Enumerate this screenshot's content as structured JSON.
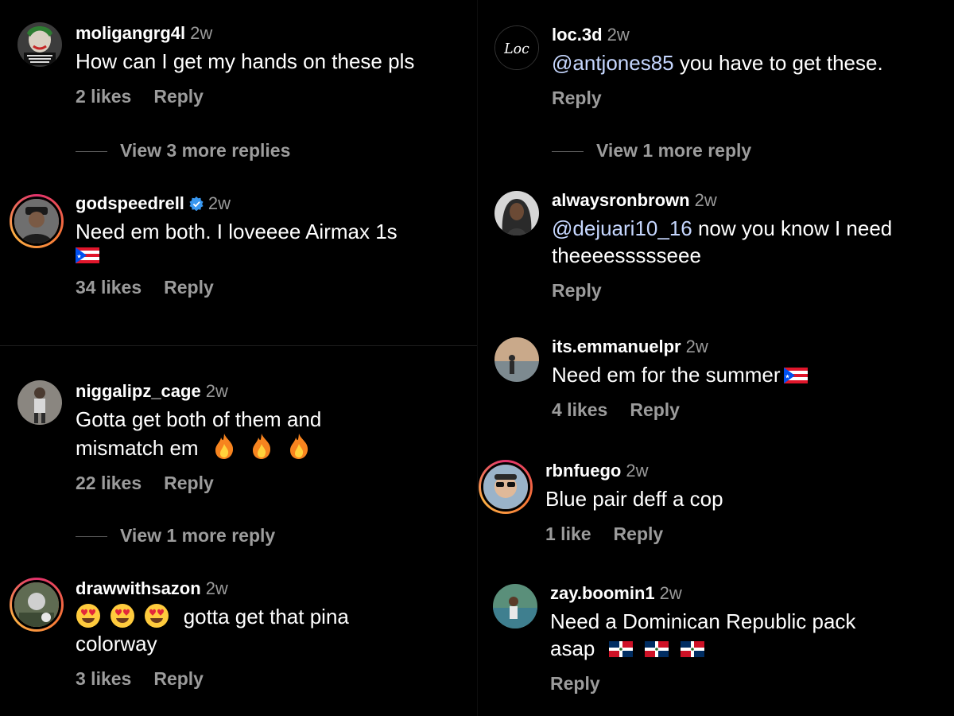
{
  "comments": [
    {
      "username": "moligangrg4l",
      "time": "2w",
      "text": "How can I get my hands on these pls",
      "likes": "2 likes",
      "reply": "Reply"
    },
    {
      "username": "godspeedrell",
      "time": "2w",
      "text": "Need em both. I loveeee Airmax 1s",
      "likes": "34 likes",
      "reply": "Reply",
      "verified": true
    },
    {
      "username": "niggalipz_cage",
      "time": "2w",
      "text_line1": "Gotta get both of them and",
      "text_line2": "mismatch em",
      "likes": "22 likes",
      "reply": "Reply"
    },
    {
      "username": "drawwithsazon",
      "time": "2w",
      "text_line1": "gotta get that pina",
      "text_line2": "colorway",
      "likes": "3 likes",
      "reply": "Reply"
    },
    {
      "username": "loc.3d",
      "time": "2w",
      "mention": "@antjones85",
      "text": " you have to get these.",
      "reply": "Reply",
      "avatar_text": "Loc"
    },
    {
      "username": "alwaysronbrown",
      "time": "2w",
      "mention": "@dejuari10_16",
      "text_line1": " now you know I need",
      "text_line2": "theeeessssseee",
      "reply": "Reply"
    },
    {
      "username": "its.emmanuelpr",
      "time": "2w",
      "text": "Need em for the summer",
      "likes": "4 likes",
      "reply": "Reply"
    },
    {
      "username": "rbnfuego",
      "time": "2w",
      "text": "Blue pair deff a cop",
      "likes": "1 like",
      "reply": "Reply"
    },
    {
      "username": "zay.boomin1",
      "time": "2w",
      "text_line1": "Need a Dominican Republic pack",
      "text_line2": "asap",
      "reply": "Reply"
    }
  ],
  "view_more": [
    "View 3 more replies",
    "View 1 more reply",
    "View 1 more reply"
  ],
  "colors": {
    "background": "#000000",
    "muted": "#9c9c9c",
    "mention": "#c6d7ff",
    "verified": "#3897f0"
  },
  "icons": {
    "verified": "verified-badge-icon",
    "flag_pr": "puerto-rico-flag-icon",
    "flag_do": "dominican-flag-icon",
    "fire": "fire-emoji-icon",
    "heart_eyes": "heart-eyes-emoji-icon"
  }
}
